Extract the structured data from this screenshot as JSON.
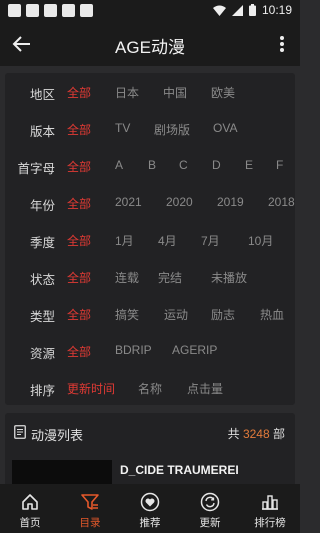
{
  "status_bar": {
    "time": "10:19"
  },
  "app_bar": {
    "title": "AGE动漫"
  },
  "filters": [
    {
      "label": "地区",
      "options": [
        "全部",
        "日本",
        "中国",
        "欧美"
      ],
      "selected": 0
    },
    {
      "label": "版本",
      "options": [
        "全部",
        "TV",
        "剧场版",
        "OVA"
      ],
      "selected": 0
    },
    {
      "label": "首字母",
      "options": [
        "全部",
        "A",
        "B",
        "C",
        "D",
        "E",
        "F"
      ],
      "selected": 0
    },
    {
      "label": "年份",
      "options": [
        "全部",
        "2021",
        "2020",
        "2019",
        "2018"
      ],
      "selected": 0
    },
    {
      "label": "季度",
      "options": [
        "全部",
        "1月",
        "4月",
        "7月",
        "10月"
      ],
      "selected": 0
    },
    {
      "label": "状态",
      "options": [
        "全部",
        "连载",
        "完结",
        "未播放"
      ],
      "selected": 0
    },
    {
      "label": "类型",
      "options": [
        "全部",
        "搞笑",
        "运动",
        "励志",
        "热血"
      ],
      "selected": 0
    },
    {
      "label": "资源",
      "options": [
        "全部",
        "BDRIP",
        "AGERIP"
      ],
      "selected": 0
    },
    {
      "label": "排序",
      "options": [
        "更新时间",
        "名称",
        "点击量"
      ],
      "selected": 0
    }
  ],
  "anime_list": {
    "title": "动漫列表",
    "count_prefix": "共",
    "count": "3248",
    "count_suffix": "部",
    "items": [
      {
        "title": "D_CIDE TRAUMEREI"
      }
    ]
  },
  "bottom_nav": [
    {
      "label": "首页",
      "icon": "home-icon"
    },
    {
      "label": "目录",
      "icon": "catalog-filter-icon",
      "active": true
    },
    {
      "label": "推荐",
      "icon": "heart-icon"
    },
    {
      "label": "更新",
      "icon": "refresh-icon"
    },
    {
      "label": "排行榜",
      "icon": "ranking-icon"
    }
  ],
  "colors": {
    "selected": "#e03a34",
    "accent": "#e6592b",
    "count": "#e27b3b",
    "background": "#2b2b2d",
    "card": "#222224",
    "bar": "#1b1b1b"
  }
}
